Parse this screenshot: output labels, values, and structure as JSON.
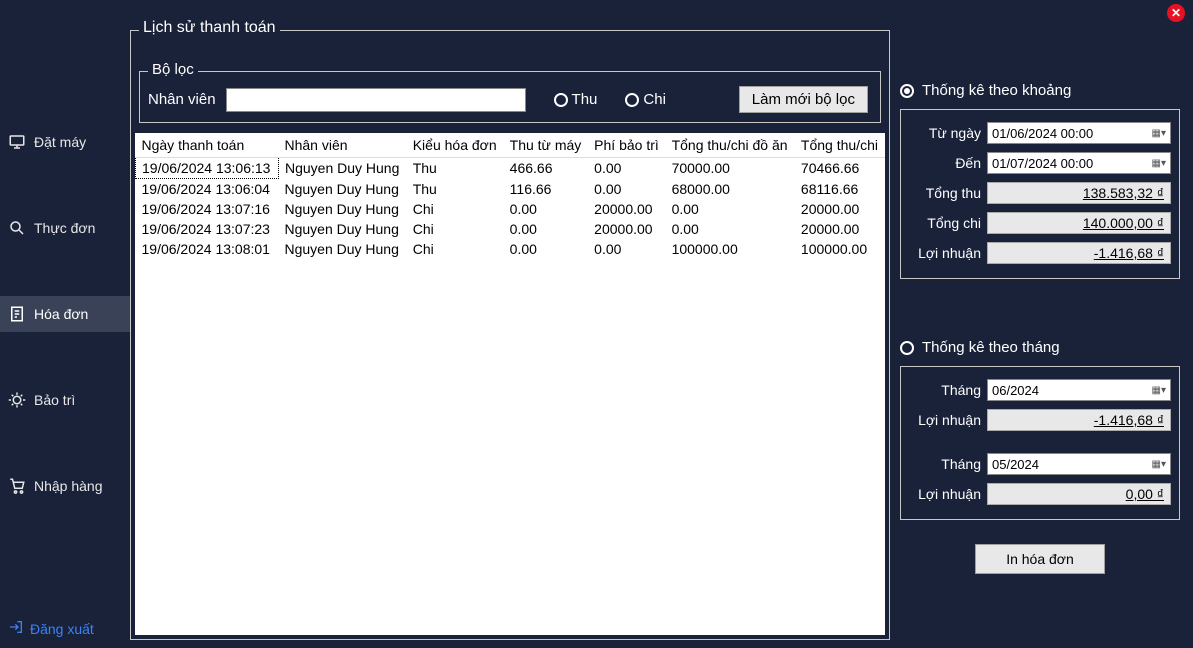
{
  "close_icon": "✕",
  "sidebar": {
    "items": [
      {
        "label": "Đặt máy",
        "icon": "computer"
      },
      {
        "label": "Thực đơn",
        "icon": "search"
      },
      {
        "label": "Hóa đơn",
        "icon": "invoice",
        "active": true
      },
      {
        "label": "Bảo trì",
        "icon": "bug"
      },
      {
        "label": "Nhập hàng",
        "icon": "cart"
      }
    ],
    "logout": "Đăng xuất"
  },
  "history": {
    "title": "Lịch sử thanh toán",
    "filter": {
      "title": "Bộ lọc",
      "employee_label": "Nhân viên",
      "employee_value": "",
      "thu_label": "Thu",
      "chi_label": "Chi",
      "refresh_label": "Làm mới bộ lọc"
    },
    "columns": [
      "Ngày thanh toán",
      "Nhân viên",
      "Kiểu hóa đơn",
      "Thu từ máy",
      "Phí bảo trì",
      "Tổng thu/chi đồ ăn",
      "Tổng thu/chi"
    ],
    "rows": [
      {
        "c0": "19/06/2024 13:06:13",
        "c1": "Nguyen Duy Hung",
        "c2": "Thu",
        "c3": "466.66",
        "c4": "0.00",
        "c5": "70000.00",
        "c6": "70466.66"
      },
      {
        "c0": "19/06/2024 13:06:04",
        "c1": "Nguyen Duy Hung",
        "c2": "Thu",
        "c3": "116.66",
        "c4": "0.00",
        "c5": "68000.00",
        "c6": "68116.66"
      },
      {
        "c0": "19/06/2024 13:07:16",
        "c1": "Nguyen Duy Hung",
        "c2": "Chi",
        "c3": "0.00",
        "c4": "20000.00",
        "c5": "0.00",
        "c6": "20000.00"
      },
      {
        "c0": "19/06/2024 13:07:23",
        "c1": "Nguyen Duy Hung",
        "c2": "Chi",
        "c3": "0.00",
        "c4": "20000.00",
        "c5": "0.00",
        "c6": "20000.00"
      },
      {
        "c0": "19/06/2024 13:08:01",
        "c1": "Nguyen Duy Hung",
        "c2": "Chi",
        "c3": "0.00",
        "c4": "0.00",
        "c5": "100000.00",
        "c6": "100000.00"
      }
    ]
  },
  "stats_range": {
    "radio_label": "Thống kê theo khoảng",
    "from_label": "Từ ngày",
    "from_value": "01/06/2024 00:00",
    "to_label": "Đến",
    "to_value": "01/07/2024 00:00",
    "tong_thu_label": "Tổng thu",
    "tong_thu_value": "138.583,32 ₫",
    "tong_chi_label": "Tổng chi",
    "tong_chi_value": "140.000,00 ₫",
    "loi_nhuan_label": "Lợi nhuận",
    "loi_nhuan_value": "-1.416,68 ₫"
  },
  "stats_month": {
    "radio_label": "Thống kê theo tháng",
    "m1_label": "Tháng",
    "m1_value": "06/2024",
    "m1_profit_label": "Lợi nhuận",
    "m1_profit_value": "-1.416,68 ₫",
    "m2_label": "Tháng",
    "m2_value": "05/2024",
    "m2_profit_label": "Lợi nhuận",
    "m2_profit_value": "0,00 ₫"
  },
  "print_label": "In hóa đơn"
}
